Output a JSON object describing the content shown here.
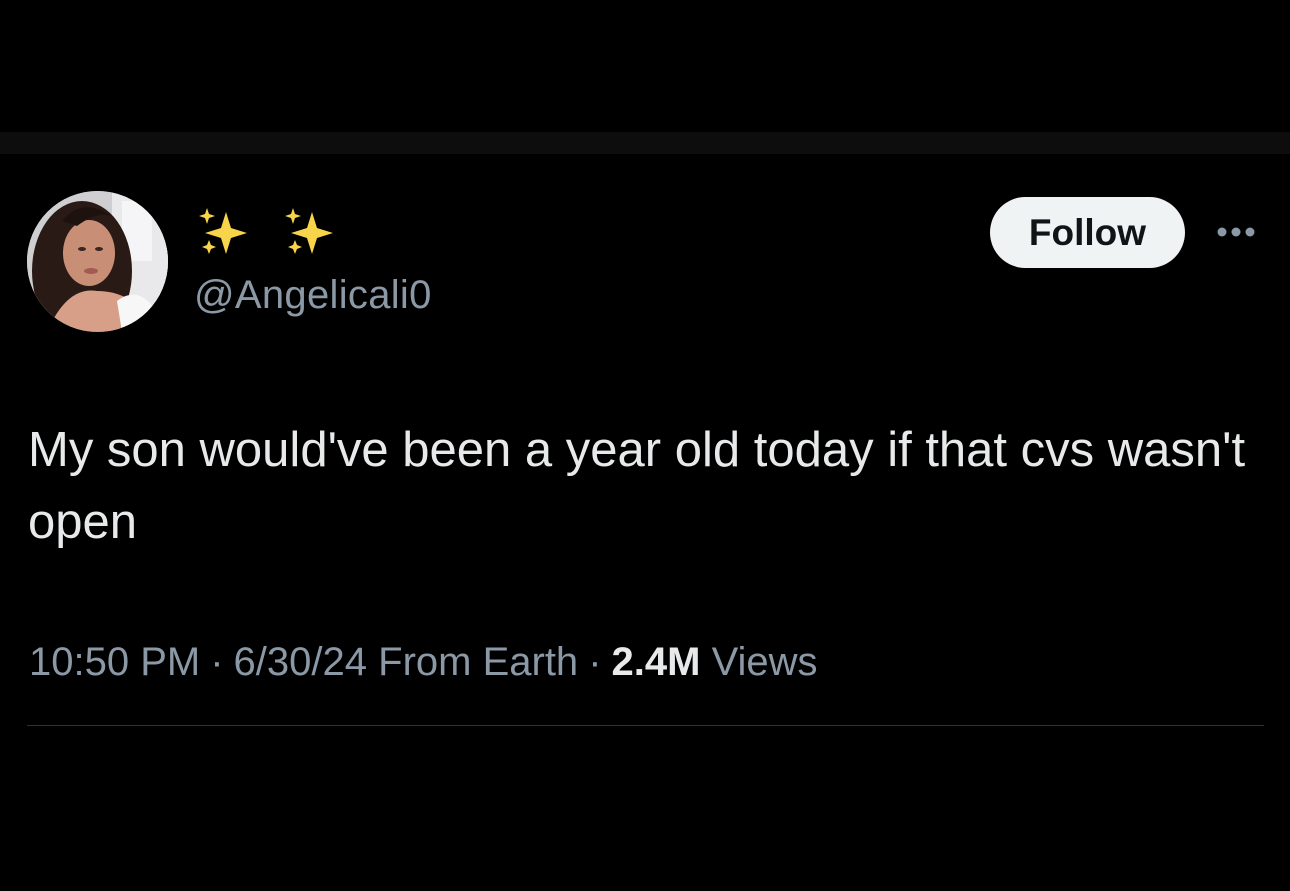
{
  "tweet": {
    "author": {
      "display_name": "✨ ✨",
      "handle": "@Angelicali0",
      "avatar_icon": "profile-photo"
    },
    "follow_label": "Follow",
    "more_icon": "more-horizontal-icon",
    "text": "My son would've been a year old today if that cvs wasn't open",
    "meta": {
      "time": "10:50 PM",
      "separator": "·",
      "date": "6/30/24",
      "source": "From Earth",
      "views_count": "2.4M",
      "views_label": "Views"
    }
  },
  "colors": {
    "background": "#000000",
    "primary_text": "#e7e9ea",
    "secondary_text": "#8b98a5",
    "follow_bg": "#eff3f4",
    "follow_text": "#0f1419",
    "divider": "#2f3336"
  }
}
